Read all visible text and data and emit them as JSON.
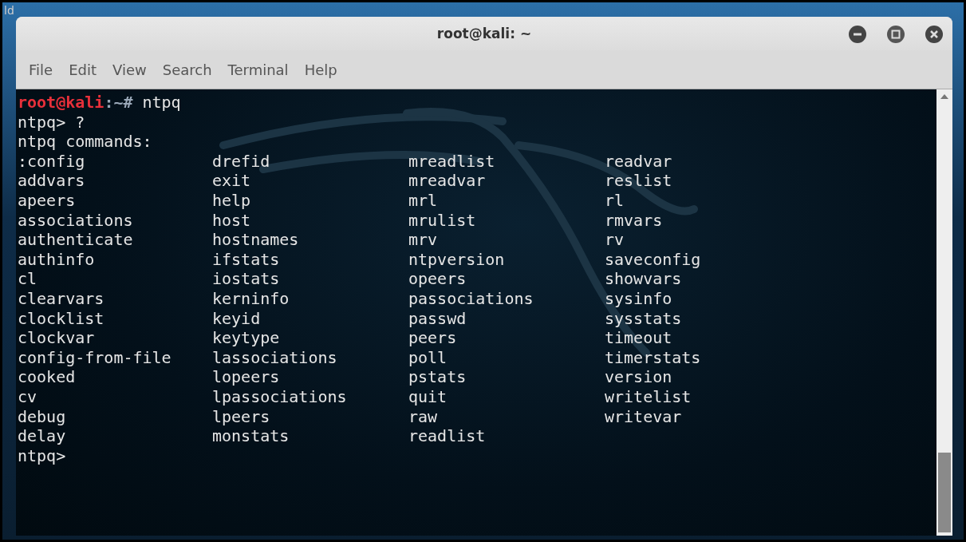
{
  "desktop": {
    "label": "ld"
  },
  "window": {
    "title": "root@kali: ~"
  },
  "menu": [
    "File",
    "Edit",
    "View",
    "Search",
    "Terminal",
    "Help"
  ],
  "terminal": {
    "prompt": {
      "user": "root@kali",
      "path": ":~#",
      "command": "ntpq"
    },
    "lines": [
      "ntpq> ?",
      "ntpq commands:"
    ],
    "commands": [
      [
        ":config",
        "drefid",
        "mreadlist",
        "readvar"
      ],
      [
        "addvars",
        "exit",
        "mreadvar",
        "reslist"
      ],
      [
        "apeers",
        "help",
        "mrl",
        "rl"
      ],
      [
        "associations",
        "host",
        "mrulist",
        "rmvars"
      ],
      [
        "authenticate",
        "hostnames",
        "mrv",
        "rv"
      ],
      [
        "authinfo",
        "ifstats",
        "ntpversion",
        "saveconfig"
      ],
      [
        "cl",
        "iostats",
        "opeers",
        "showvars"
      ],
      [
        "clearvars",
        "kerninfo",
        "passociations",
        "sysinfo"
      ],
      [
        "clocklist",
        "keyid",
        "passwd",
        "sysstats"
      ],
      [
        "clockvar",
        "keytype",
        "peers",
        "timeout"
      ],
      [
        "config-from-file",
        "lassociations",
        "poll",
        "timerstats"
      ],
      [
        "cooked",
        "lopeers",
        "pstats",
        "version"
      ],
      [
        "cv",
        "lpassociations",
        "quit",
        "writelist"
      ],
      [
        "debug",
        "lpeers",
        "raw",
        "writevar"
      ],
      [
        "delay",
        "monstats",
        "readlist"
      ]
    ],
    "final_prompt": "ntpq>"
  }
}
